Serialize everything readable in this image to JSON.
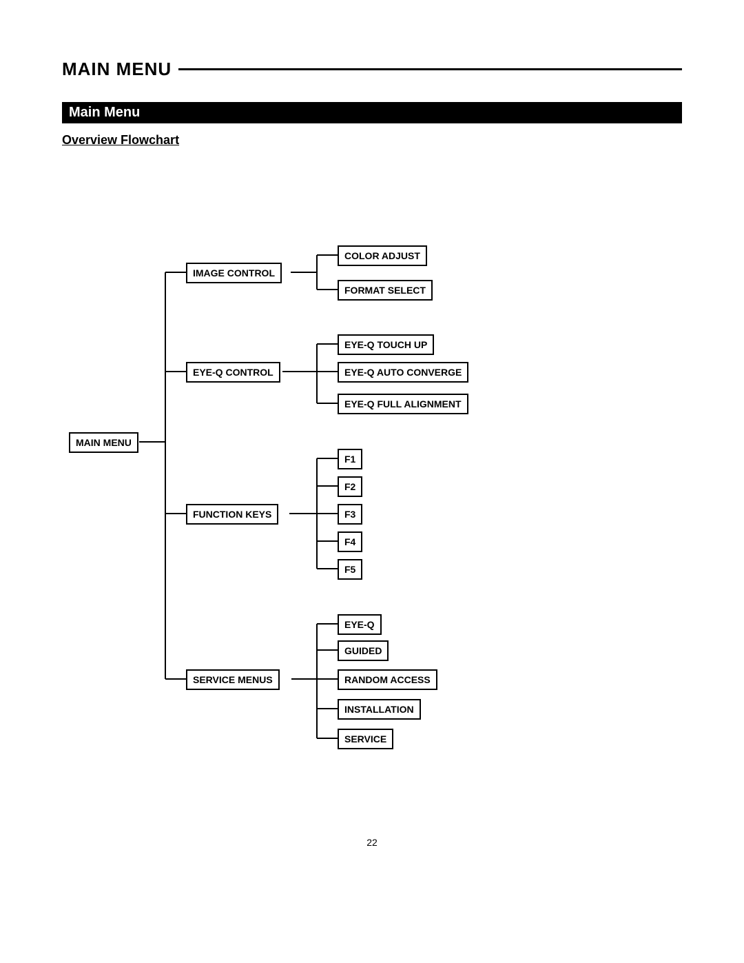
{
  "header": {
    "title": "MAIN MENU",
    "section_title": "Main Menu",
    "subhead": "Overview Flowchart"
  },
  "page_number": "22",
  "flow": {
    "root": "MAIN MENU",
    "branches": [
      {
        "label": "IMAGE CONTROL",
        "children": [
          "COLOR ADJUST",
          "FORMAT SELECT"
        ]
      },
      {
        "label": "EYE-Q CONTROL",
        "children": [
          "EYE-Q TOUCH UP",
          "EYE-Q AUTO CONVERGE",
          "EYE-Q FULL ALIGNMENT"
        ]
      },
      {
        "label": "FUNCTION KEYS",
        "children": [
          "F1",
          "F2",
          "F3",
          "F4",
          "F5"
        ]
      },
      {
        "label": "SERVICE MENUS",
        "children": [
          "EYE-Q",
          "GUIDED",
          "RANDOM ACCESS",
          "INSTALLATION",
          "SERVICE"
        ]
      }
    ]
  }
}
